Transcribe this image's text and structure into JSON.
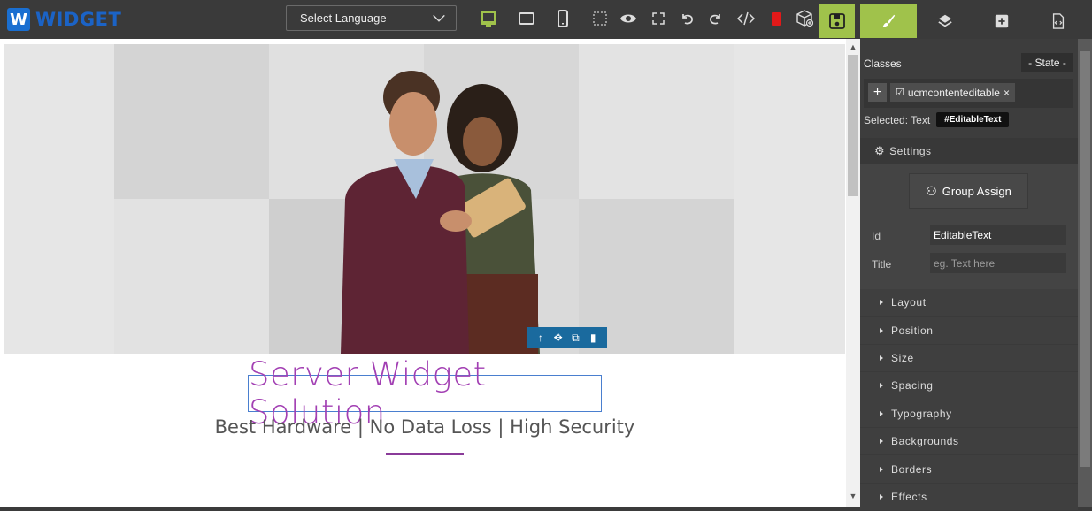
{
  "brand": {
    "letter": "W",
    "name": "WIDGET"
  },
  "toolbar": {
    "language_select": "Select Language",
    "icons": [
      "desktop-icon",
      "tablet-icon",
      "mobile-icon",
      "outline-icon",
      "preview-icon",
      "fullscreen-icon",
      "undo-icon",
      "redo-icon",
      "code-icon",
      "clear-icon",
      "import-icon"
    ],
    "save_icon": "save-icon",
    "tabs": [
      "style-manager-icon",
      "layer-manager-icon",
      "blocks-icon",
      "code-view-icon"
    ]
  },
  "canvas": {
    "headline": "Server Widget Solution",
    "subline": "Best Hardware | No Data Loss | High Security",
    "mini_toolbar": [
      "↑",
      "✥",
      "⧉",
      "🗑"
    ]
  },
  "panel": {
    "classes_label": "Classes",
    "state_label": "- State -",
    "add_label": "+",
    "tag": "ucmcontenteditable",
    "selected_label": "Selected: Text",
    "selected_badge": "#EditableText",
    "settings_label": "Settings",
    "group_assign": "Group Assign",
    "id_label": "Id",
    "id_value": "EditableText",
    "title_label": "Title",
    "title_placeholder": "eg. Text here",
    "sections": [
      "Layout",
      "Position",
      "Size",
      "Spacing",
      "Typography",
      "Backgrounds",
      "Borders",
      "Effects"
    ]
  },
  "colors": {
    "accent": "#a0c24b",
    "brand": "#1b63c6",
    "headline": "#a23fb3"
  }
}
